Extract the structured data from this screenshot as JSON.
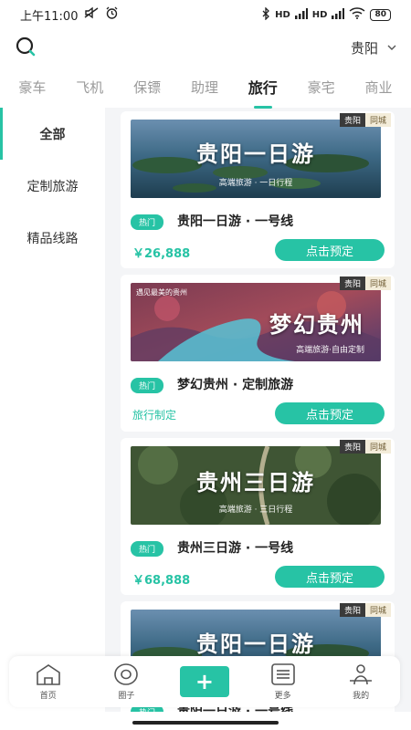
{
  "status_bar": {
    "time": "上午11:00",
    "battery": "80",
    "network_1": "HD",
    "network_2": "HD"
  },
  "header": {
    "city": "贵阳"
  },
  "tabs": [
    "豪车",
    "飞机",
    "保镖",
    "助理",
    "旅行",
    "豪宅",
    "商业"
  ],
  "active_tab": 4,
  "side_nav": [
    "全部",
    "定制旅游",
    "精品线路"
  ],
  "cards": [
    {
      "tag_city": "贵阳",
      "tag_type": "同城",
      "banner_title": "贵阳一日游",
      "banner_sub": "高端旅游 · 一日行程",
      "hot": "热门",
      "name": "贵阳一日游 · 一号线",
      "price": "￥26,888",
      "button": "点击预定"
    },
    {
      "tag_city": "贵阳",
      "tag_type": "同城",
      "banner_top": "遇见最美的贵州",
      "banner_title": "梦幻贵州",
      "banner_sub": "高端旅游·自由定制",
      "hot": "热门",
      "name": "梦幻贵州 · 定制旅游",
      "price": "旅行制定",
      "button": "点击预定"
    },
    {
      "tag_city": "贵阳",
      "tag_type": "同城",
      "banner_title": "贵州三日游",
      "banner_sub": "高端旅游 · 三日行程",
      "hot": "热门",
      "name": "贵州三日游 · 一号线",
      "price": "￥68,888",
      "button": "点击预定"
    },
    {
      "tag_city": "贵阳",
      "tag_type": "同城",
      "banner_title": "贵阳一日游",
      "banner_sub": "",
      "hot": "热门",
      "name": "贵阳一日游 · 一号线",
      "price": "",
      "button": ""
    }
  ],
  "bottom_nav": {
    "home": "首页",
    "circle": "圈子",
    "plus": "+",
    "more": "更多",
    "mine": "我的"
  },
  "colors": {
    "accent": "#27c3a5",
    "tag_dark": "#3a3a3a",
    "tag_light": "#f3ecd9"
  }
}
